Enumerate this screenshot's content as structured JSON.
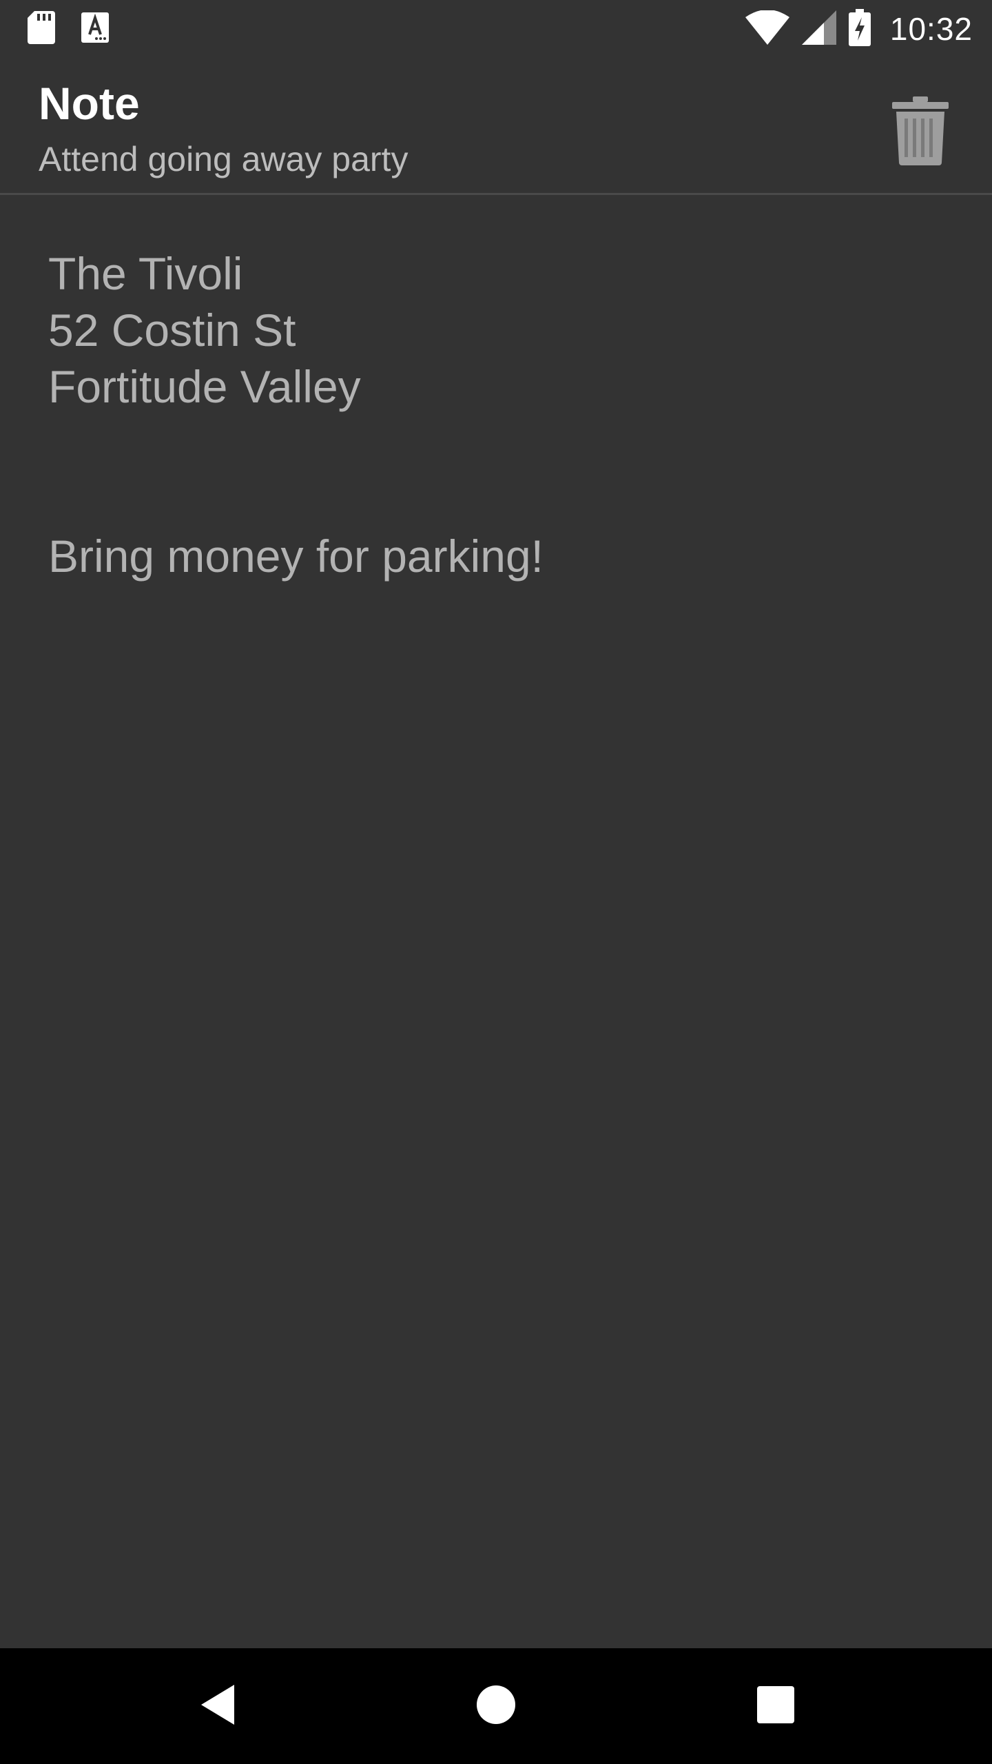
{
  "status_bar": {
    "time": "10:32",
    "icons": [
      "sd-card-icon",
      "text-notification-icon",
      "wifi-icon",
      "cell-signal-icon",
      "battery-charging-icon"
    ]
  },
  "header": {
    "title": "Note",
    "subtitle": "Attend going away party",
    "delete_icon": "trash-icon"
  },
  "note": {
    "lines": [
      "The Tivoli",
      "52 Costin St",
      "Fortitude Valley",
      "",
      "",
      "Bring money for parking!"
    ]
  },
  "nav_bar": {
    "icons": [
      "back-icon",
      "home-icon",
      "recents-icon"
    ]
  },
  "colors": {
    "background": "#333333",
    "title_text": "#ffffff",
    "subtitle_text": "#bdbdbd",
    "body_text": "#b3b3b3",
    "icon_gray": "#9e9e9e",
    "nav_background": "#000000"
  }
}
